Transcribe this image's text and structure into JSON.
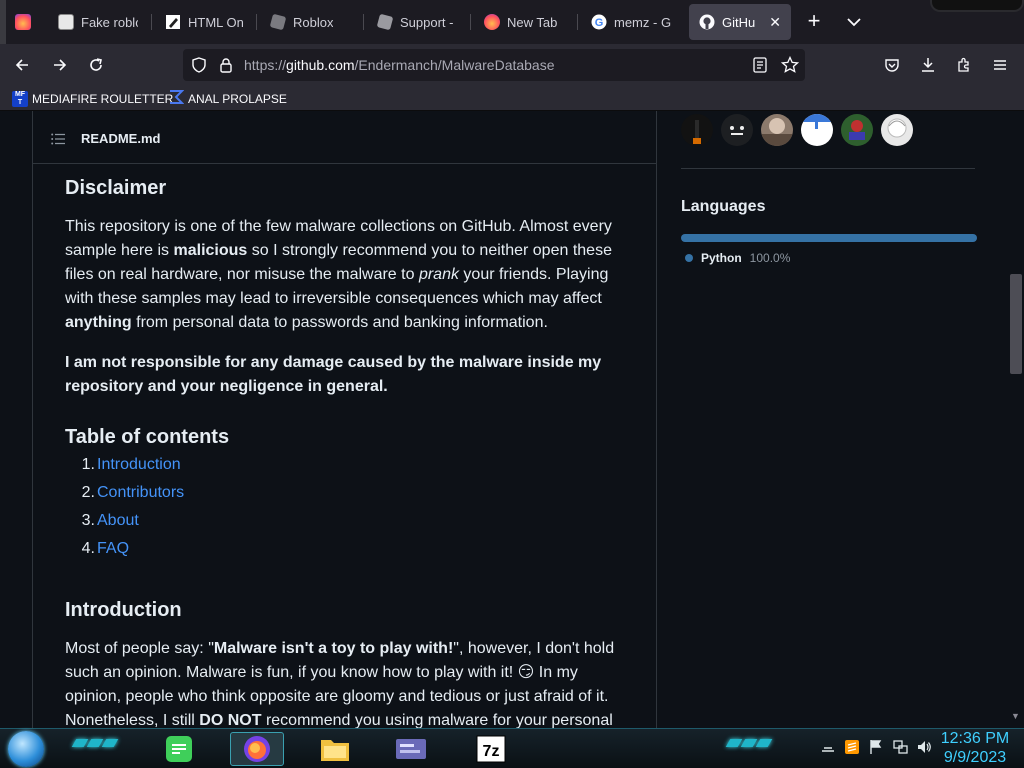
{
  "tabs": [
    {
      "label": "",
      "icon": "firefox-icon"
    },
    {
      "label": "Fake roblox",
      "icon": "fake-roblox-icon"
    },
    {
      "label": "HTML Onli",
      "icon": "html-editor-icon"
    },
    {
      "label": "Roblox",
      "icon": "roblox-icon"
    },
    {
      "label": "Support - F",
      "icon": "roblox-icon"
    },
    {
      "label": "New Tab",
      "icon": "firefox-icon"
    },
    {
      "label": "memz - Goo",
      "icon": "google-icon"
    },
    {
      "label": "GitHub -",
      "icon": "github-icon",
      "active": true
    }
  ],
  "address": {
    "url_prefix": "https://",
    "url_host": "github.com",
    "url_path": "/Endermanch/MalwareDatabase"
  },
  "bookmarks": [
    {
      "label": "MEDIAFIRE ROULETTER",
      "icon_text": "MF T"
    },
    {
      "label": "ANAL PROLAPSE"
    }
  ],
  "readme": {
    "filename": "README.md",
    "disclaimer_heading": "Disclaimer",
    "disclaimer_p1": {
      "t1": "This repository is one of the few malware collections on GitHub. Almost every sample here is ",
      "b1": "malicious",
      "t2": " so I strongly recommend you to neither open these files on real hardware, nor misuse the malware to ",
      "i1": "prank",
      "t3": " your friends. Playing with these samples may lead to irreversible consequences which may affect ",
      "b2": "anything",
      "t4": " from personal data to passwords and banking information."
    },
    "disclaimer_p2": "I am not responsible for any damage caused by the malware inside my repository and your negligence in general.",
    "toc_heading": "Table of contents",
    "toc": [
      {
        "num": "1.",
        "label": "Introduction"
      },
      {
        "num": "2.",
        "label": "Contributors"
      },
      {
        "num": "3.",
        "label": "About"
      },
      {
        "num": "4.",
        "label": "FAQ"
      }
    ],
    "intro_heading": "Introduction",
    "intro_p1": {
      "t1": "Most of people say: \"",
      "b1": "Malware isn't a toy to play with!",
      "t2": "\", however, I don't hold such an opinion. Malware is fun, if you know how to play with it! ",
      "emoji": "😏",
      "t3": " In my opinion, people who think opposite are gloomy and tedious or just afraid of it. Nonetheless, I still ",
      "b2": "DO NOT",
      "t4": " recommend you using malware for your personal"
    }
  },
  "sidebar": {
    "languages_heading": "Languages",
    "languages": [
      {
        "name": "Python",
        "percent": "100.0%",
        "color": "#3572a5"
      }
    ]
  },
  "taskbar": {
    "time": "12:36 PM",
    "date": "9/9/2023"
  }
}
